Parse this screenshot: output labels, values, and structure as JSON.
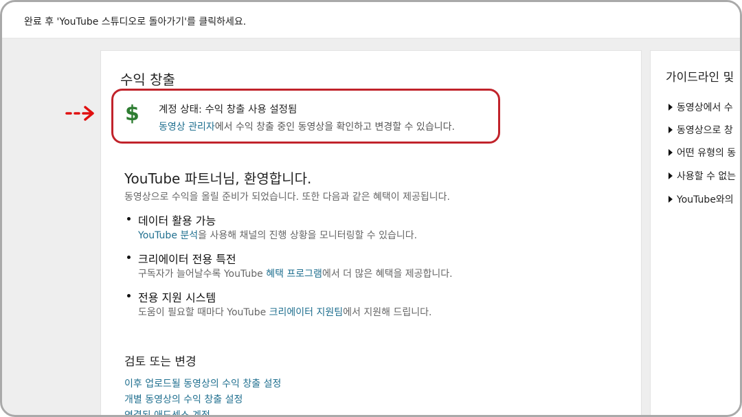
{
  "instruction": "완료 후 'YouTube 스튜디오로 돌아가기'를 클릭하세요.",
  "main": {
    "title": "수익 창출",
    "status": {
      "icon": "dollar-icon",
      "title": "계정 상태: 수익 창출 사용 설정됨",
      "desc_link": "동영상 관리자",
      "desc_text": "에서 수익 창출 중인 동영상을 확인하고 변경할 수 있습니다."
    },
    "welcome": {
      "title": "YouTube 파트너님, 환영합니다.",
      "subtitle": "동영상으로 수익을 올릴 준비가 되었습니다. 또한 다음과 같은 혜택이 제공됩니다."
    },
    "benefits": [
      {
        "title": "데이터 활용 가능",
        "pre": "",
        "link": "YouTube 분석",
        "post": "을 사용해 채널의 진행 상황을 모니터링할 수 있습니다."
      },
      {
        "title": "크리에이터 전용 특전",
        "pre": "구독자가 늘어날수록 YouTube ",
        "link": "혜택 프로그램",
        "post": "에서 더 많은 혜택을 제공합니다."
      },
      {
        "title": "전용 지원 시스템",
        "pre": "도움이 필요할 때마다 YouTube ",
        "link": "크리에이터 지원팀",
        "post": "에서 지원해 드립니다."
      }
    ],
    "review": {
      "title": "검토 또는 변경",
      "links": [
        "이후 업로드될 동영상의 수익 창출 설정",
        "개별 동영상의 수익 창출 설정",
        "연결된 애드센스 계정"
      ]
    }
  },
  "sidebar": {
    "title": "가이드라인 및",
    "items": [
      "동영상에서 수",
      "동영상으로 창",
      "어떤 유형의 동",
      "사용할 수 없는",
      "YouTube와의 "
    ]
  },
  "colors": {
    "highlight": "#c1232b",
    "arrow": "#e01010",
    "link": "#1f6f8f",
    "dollar": "#2e7d32"
  }
}
